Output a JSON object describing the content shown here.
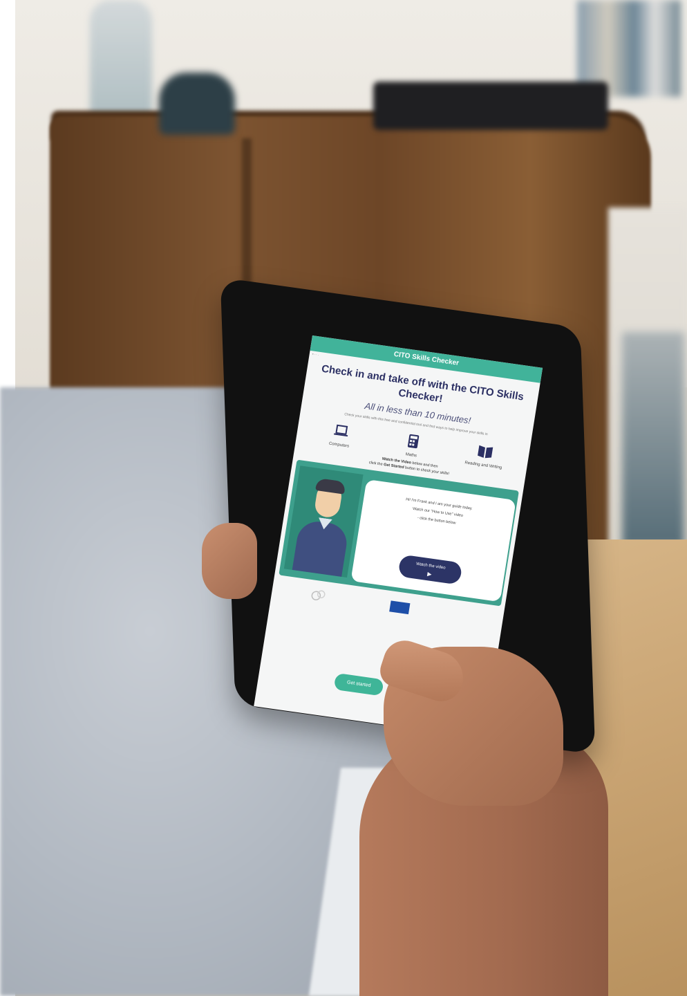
{
  "app": {
    "title": "CITO Skills Checker",
    "headline": "Check in and take off with the CITO Skills Checker!",
    "subhead": "All in less than 10 minutes!",
    "intro": "Check your skills with this free and confidential tool and find ways to help improve your skills in"
  },
  "features": [
    {
      "label": "Computers",
      "icon": "laptop-icon"
    },
    {
      "label": "Maths",
      "icon": "calculator-icon"
    },
    {
      "label": "Reading and Writing",
      "icon": "book-icon"
    }
  ],
  "instructions": {
    "line1_bold": "Watch the Video",
    "line1_rest": " below and then",
    "line2_pre": "click the ",
    "line2_bold": "Get Started",
    "line2_rest": " button to check your skills!"
  },
  "guide": {
    "lines": [
      "Hi! I'm Frank and I am your guide today.",
      "Watch our \"How to Use\" video",
      "- click the button below"
    ],
    "watch_button": "Watch the video"
  },
  "cta": {
    "get_started": "Get started"
  },
  "colors": {
    "brand_teal": "#41b39a",
    "navy": "#2c3466",
    "eu_blue": "#1e4fa8"
  }
}
